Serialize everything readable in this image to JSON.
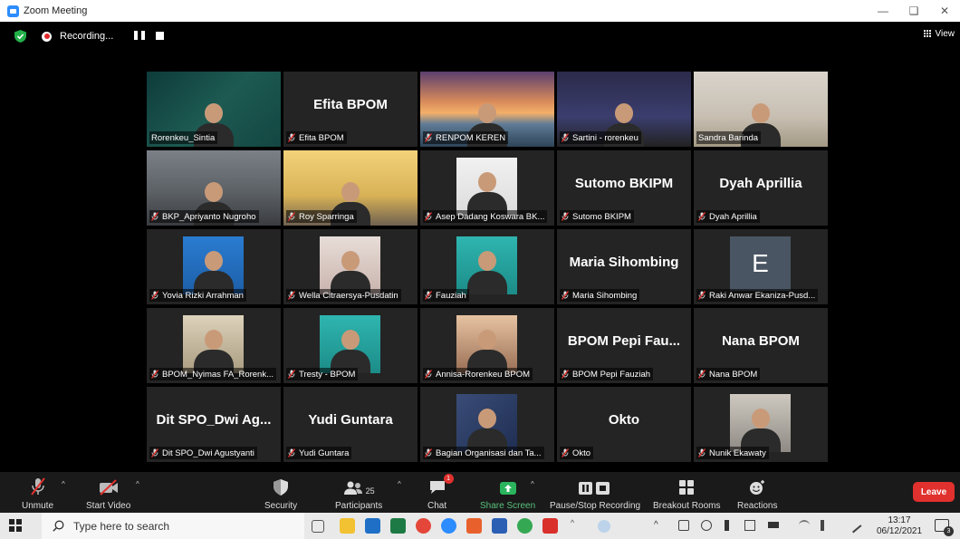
{
  "window": {
    "title": "Zoom Meeting",
    "view_label": "View"
  },
  "recording": {
    "status_label": "Recording..."
  },
  "participants_grid": [
    {
      "label": "Rorenkeu_Sintia",
      "big_name": "",
      "muted": false,
      "video": true,
      "bg": "grad-green",
      "active": true
    },
    {
      "label": "Efita BPOM",
      "big_name": "Efita BPOM",
      "muted": true,
      "video": false
    },
    {
      "label": "RENPOM KEREN",
      "big_name": "",
      "muted": true,
      "video": true,
      "bg": "grad-sea"
    },
    {
      "label": "Sartini - rorenkeu",
      "big_name": "",
      "muted": true,
      "video": true,
      "bg": "grad-office"
    },
    {
      "label": "Sandra Barinda",
      "big_name": "",
      "muted": false,
      "video": true,
      "bg": "grad-room"
    },
    {
      "label": "BKP_Apriyanto Nugroho",
      "big_name": "",
      "muted": true,
      "video": true,
      "bg": "grad-car"
    },
    {
      "label": "Roy Sparringa",
      "big_name": "",
      "muted": true,
      "video": true,
      "bg": "grad-yellow"
    },
    {
      "label": "Asep Dadang Koswara BK...",
      "big_name": "",
      "muted": true,
      "video": true,
      "bg": "grad-white",
      "small": true
    },
    {
      "label": "Sutomo BKIPM",
      "big_name": "Sutomo BKIPM",
      "muted": true,
      "video": false
    },
    {
      "label": "Dyah Aprillia",
      "big_name": "Dyah Aprillia",
      "muted": true,
      "video": false
    },
    {
      "label": "Yovia Rizki Arrahman",
      "big_name": "",
      "muted": true,
      "video": true,
      "bg": "grad-blue",
      "small": true
    },
    {
      "label": "Wella Citraersya-Pusdatin",
      "big_name": "",
      "muted": true,
      "video": true,
      "bg": "grad-pink",
      "small": true
    },
    {
      "label": "Fauziah",
      "big_name": "",
      "muted": true,
      "video": true,
      "bg": "grad-teal",
      "small": true
    },
    {
      "label": "Maria Sihombing",
      "big_name": "Maria Sihombing",
      "muted": true,
      "video": false
    },
    {
      "label": "Raki Anwar Ekaniza-Pusd...",
      "big_name": "",
      "muted": true,
      "video": false,
      "avatar_letter": "E"
    },
    {
      "label": "BPOM_Nyimas FA_Rorenk...",
      "big_name": "",
      "muted": true,
      "video": true,
      "bg": "grad-cream",
      "small": true
    },
    {
      "label": "Tresty - BPOM",
      "big_name": "",
      "muted": true,
      "video": true,
      "bg": "grad-teal",
      "small": true
    },
    {
      "label": "Annisa-Rorenkeu BPOM",
      "big_name": "",
      "muted": true,
      "video": true,
      "bg": "grad-orange",
      "small": true
    },
    {
      "label": "BPOM Pepi Fauziah",
      "big_name": "BPOM Pepi Fau...",
      "muted": true,
      "video": false
    },
    {
      "label": "Nana BPOM",
      "big_name": "Nana BPOM",
      "muted": true,
      "video": false
    },
    {
      "label": "Dit SPO_Dwi Agustyanti",
      "big_name": "Dit SPO_Dwi Ag...",
      "muted": true,
      "video": false
    },
    {
      "label": "Yudi Guntara",
      "big_name": "Yudi Guntara",
      "muted": true,
      "video": false
    },
    {
      "label": "Bagian Organisasi dan Ta...",
      "big_name": "",
      "muted": true,
      "video": true,
      "bg": "grad-navy",
      "small": true
    },
    {
      "label": "Okto",
      "big_name": "Okto",
      "muted": true,
      "video": false
    },
    {
      "label": "Nunik Ekawaty",
      "big_name": "",
      "muted": true,
      "video": true,
      "bg": "grad-office2",
      "small": true
    }
  ],
  "toolbar": {
    "unmute": "Unmute",
    "start_video": "Start Video",
    "security": "Security",
    "participants": "Participants",
    "participants_count": "25",
    "chat": "Chat",
    "chat_badge": "1",
    "share_screen": "Share Screen",
    "pause_stop_recording": "Pause/Stop Recording",
    "breakout_rooms": "Breakout Rooms",
    "reactions": "Reactions",
    "leave": "Leave"
  },
  "taskbar": {
    "search_placeholder": "Type here to search",
    "time": "13:17",
    "date": "06/12/2021",
    "notification_count": "3"
  },
  "colors": {
    "active_speaker_border": "#c9d341",
    "leave_red": "#e0312e",
    "share_green": "#58c17a",
    "tile_bg": "#242424"
  }
}
